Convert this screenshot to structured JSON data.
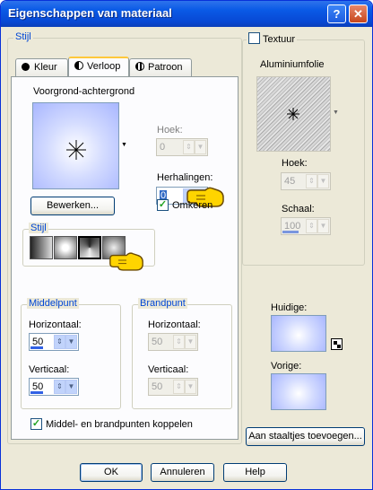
{
  "window": {
    "title": "Eigenschappen van materiaal",
    "help_glyph": "?",
    "close_glyph": "✕"
  },
  "style_group": {
    "label": "Stijl"
  },
  "tabs": [
    {
      "label": "Kleur"
    },
    {
      "label": "Verloop"
    },
    {
      "label": "Patroon"
    }
  ],
  "gradient": {
    "name": "Voorgrond-achtergrond",
    "edit_label": "Bewerken...",
    "angle_label": "Hoek:",
    "angle_value": "0",
    "repeats_label": "Herhalingen:",
    "repeats_value": "0",
    "invert_label": "Omkeren",
    "invert_checked": true,
    "style_label": "Stijl"
  },
  "center": {
    "label": "Middelpunt",
    "h_label": "Horizontaal:",
    "h_value": "50",
    "v_label": "Verticaal:",
    "v_value": "50"
  },
  "focal": {
    "label": "Brandpunt",
    "h_label": "Horizontaal:",
    "h_value": "50",
    "v_label": "Verticaal:",
    "v_value": "50"
  },
  "link_label": "Middel- en brandpunten koppelen",
  "texture": {
    "label": "Textuur",
    "name": "Aluminiumfolie",
    "angle_label": "Hoek:",
    "angle_value": "45",
    "scale_label": "Schaal:",
    "scale_value": "100"
  },
  "current_label": "Huidige:",
  "previous_label": "Vorige:",
  "add_swatch_label": "Aan staaltjes toevoegen...",
  "buttons": {
    "ok": "OK",
    "cancel": "Annuleren",
    "help": "Help"
  },
  "colors": {
    "title_bar": "#0a5ae6",
    "group_label": "#0046d5",
    "swatch_light": "#ffffff",
    "swatch_dark": "#a8b6ff"
  }
}
